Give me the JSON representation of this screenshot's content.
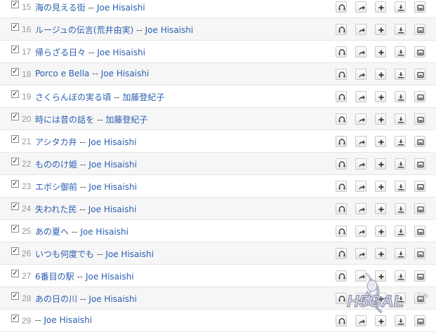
{
  "songs": [
    {
      "num": "15",
      "title": "海の見える街",
      "sep": "--",
      "artist": "Joe Hisaishi"
    },
    {
      "num": "16",
      "title": "ルージュの伝言(荒井由実)",
      "sep": "--",
      "artist": "Joe Hisaishi"
    },
    {
      "num": "17",
      "title": "帰らざる日々",
      "sep": "--",
      "artist": "Joe Hisaishi"
    },
    {
      "num": "18",
      "title": "Porco e Bella",
      "sep": "--",
      "artist": "Joe Hisaishi"
    },
    {
      "num": "19",
      "title": "さくらんぼの実る頃",
      "sep": "--",
      "artist": "加藤登紀子"
    },
    {
      "num": "20",
      "title": "時には昔の話を",
      "sep": "--",
      "artist": "加藤登紀子"
    },
    {
      "num": "21",
      "title": "アシタカ弁",
      "sep": "--",
      "artist": "Joe Hisaishi"
    },
    {
      "num": "22",
      "title": "もののけ姫",
      "sep": "--",
      "artist": "Joe Hisaishi"
    },
    {
      "num": "23",
      "title": "エボシ御前",
      "sep": "--",
      "artist": "Joe Hisaishi"
    },
    {
      "num": "24",
      "title": "失われた民",
      "sep": "--",
      "artist": "Joe Hisaishi"
    },
    {
      "num": "25",
      "title": "あの夏へ",
      "sep": "--",
      "artist": "Joe Hisaishi"
    },
    {
      "num": "26",
      "title": "いつも何度でも",
      "sep": "--",
      "artist": "Joe Hisaishi"
    },
    {
      "num": "27",
      "title": "6番目の駅",
      "sep": "--",
      "artist": "Joe Hisaishi"
    },
    {
      "num": "28",
      "title": "あの日の川",
      "sep": "--",
      "artist": "Joe Hisaishi"
    },
    {
      "num": "29",
      "title": "",
      "sep": "--",
      "artist": "Joe Hisaishi"
    }
  ],
  "check_mark": "✓",
  "row_actions": [
    "listen-icon",
    "share-icon",
    "add-icon",
    "download-icon",
    "play-icon"
  ],
  "watermark_text": "H5GAL",
  "watermark_suffix": "com",
  "colors": {
    "link": "#2a5db0",
    "number": "#9a9a9a",
    "row_alt": "#f6f6f6"
  }
}
